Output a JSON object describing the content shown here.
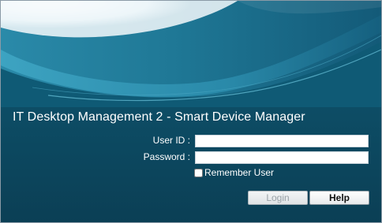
{
  "app": {
    "title": "IT Desktop Management 2 - Smart Device Manager"
  },
  "form": {
    "userid_label": "User ID :",
    "userid_value": "",
    "password_label": "Password :",
    "password_value": "",
    "remember_label": "Remember User",
    "remember_checked": false
  },
  "buttons": {
    "login_label": "Login",
    "login_enabled": false,
    "help_label": "Help"
  },
  "colors": {
    "panel_background": "#0d4a62",
    "banner_highlight": "#eef6f9",
    "banner_teal": "#2f8faf"
  }
}
